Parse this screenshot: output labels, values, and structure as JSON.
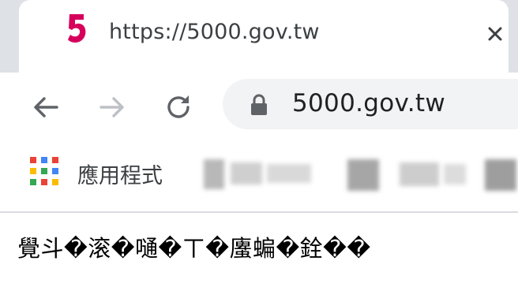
{
  "tab": {
    "title": "https://5000.gov.tw",
    "favicon": "5",
    "favicon_color": "#d6005c"
  },
  "toolbar": {
    "url": "5000.gov.tw"
  },
  "bookmarks": {
    "apps_label": "應用程式"
  },
  "page": {
    "text": "覺斗�滚�嗵�ㄒ�螷蝙�銓��"
  },
  "icons": [
    "back-arrow-icon",
    "forward-arrow-icon",
    "reload-icon",
    "lock-icon",
    "close-icon",
    "apps-grid-icon"
  ]
}
